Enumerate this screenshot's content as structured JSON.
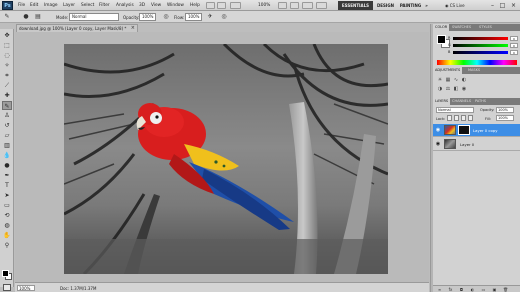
{
  "app": {
    "logo": "Ps"
  },
  "menu": {
    "items": [
      "File",
      "Edit",
      "Image",
      "Layer",
      "Select",
      "Filter",
      "Analysis",
      "3D",
      "View",
      "Window",
      "Help"
    ],
    "zoom": "100%"
  },
  "workspace": {
    "essentials": "ESSENTIALS",
    "design": "DESIGN",
    "painting": "PAINTING",
    "more": "»",
    "cs_live": "CS Live"
  },
  "options": {
    "mode_label": "Mode:",
    "mode_value": "Normal",
    "opacity_label": "Opacity:",
    "opacity_value": "100%",
    "flow_label": "Flow:",
    "flow_value": "100%"
  },
  "document": {
    "tab_title": "download.jpg @ 100% (Layer 0 copy, Layer Mask/8) *",
    "close": "×"
  },
  "status": {
    "zoom": "100%",
    "doc_info": "Doc: 1.37M/1.37M"
  },
  "panels": {
    "color_tabs": [
      "COLOR",
      "SWATCHES",
      "STYLES"
    ],
    "color_sliders": [
      {
        "label": "R",
        "value": "0"
      },
      {
        "label": "G",
        "value": "0"
      },
      {
        "label": "B",
        "value": "0"
      }
    ],
    "adjust_tabs": [
      "ADJUSTMENTS",
      "MASKS"
    ],
    "layers_tabs": [
      "LAYERS",
      "CHANNELS",
      "PATHS"
    ],
    "blend_mode": "Normal",
    "opacity_label": "Opacity:",
    "opacity_value": "100%",
    "lock_label": "Lock:",
    "fill_label": "Fill:",
    "fill_value": "100%",
    "layers": [
      {
        "name": "Layer 0 copy",
        "selected": true
      },
      {
        "name": "Layer 0",
        "selected": false
      }
    ]
  },
  "colors": {
    "accent": "#3d8ee6",
    "parrot_red": "#d81e1e",
    "parrot_yellow": "#f0c01c",
    "parrot_blue": "#1f4fa8"
  }
}
